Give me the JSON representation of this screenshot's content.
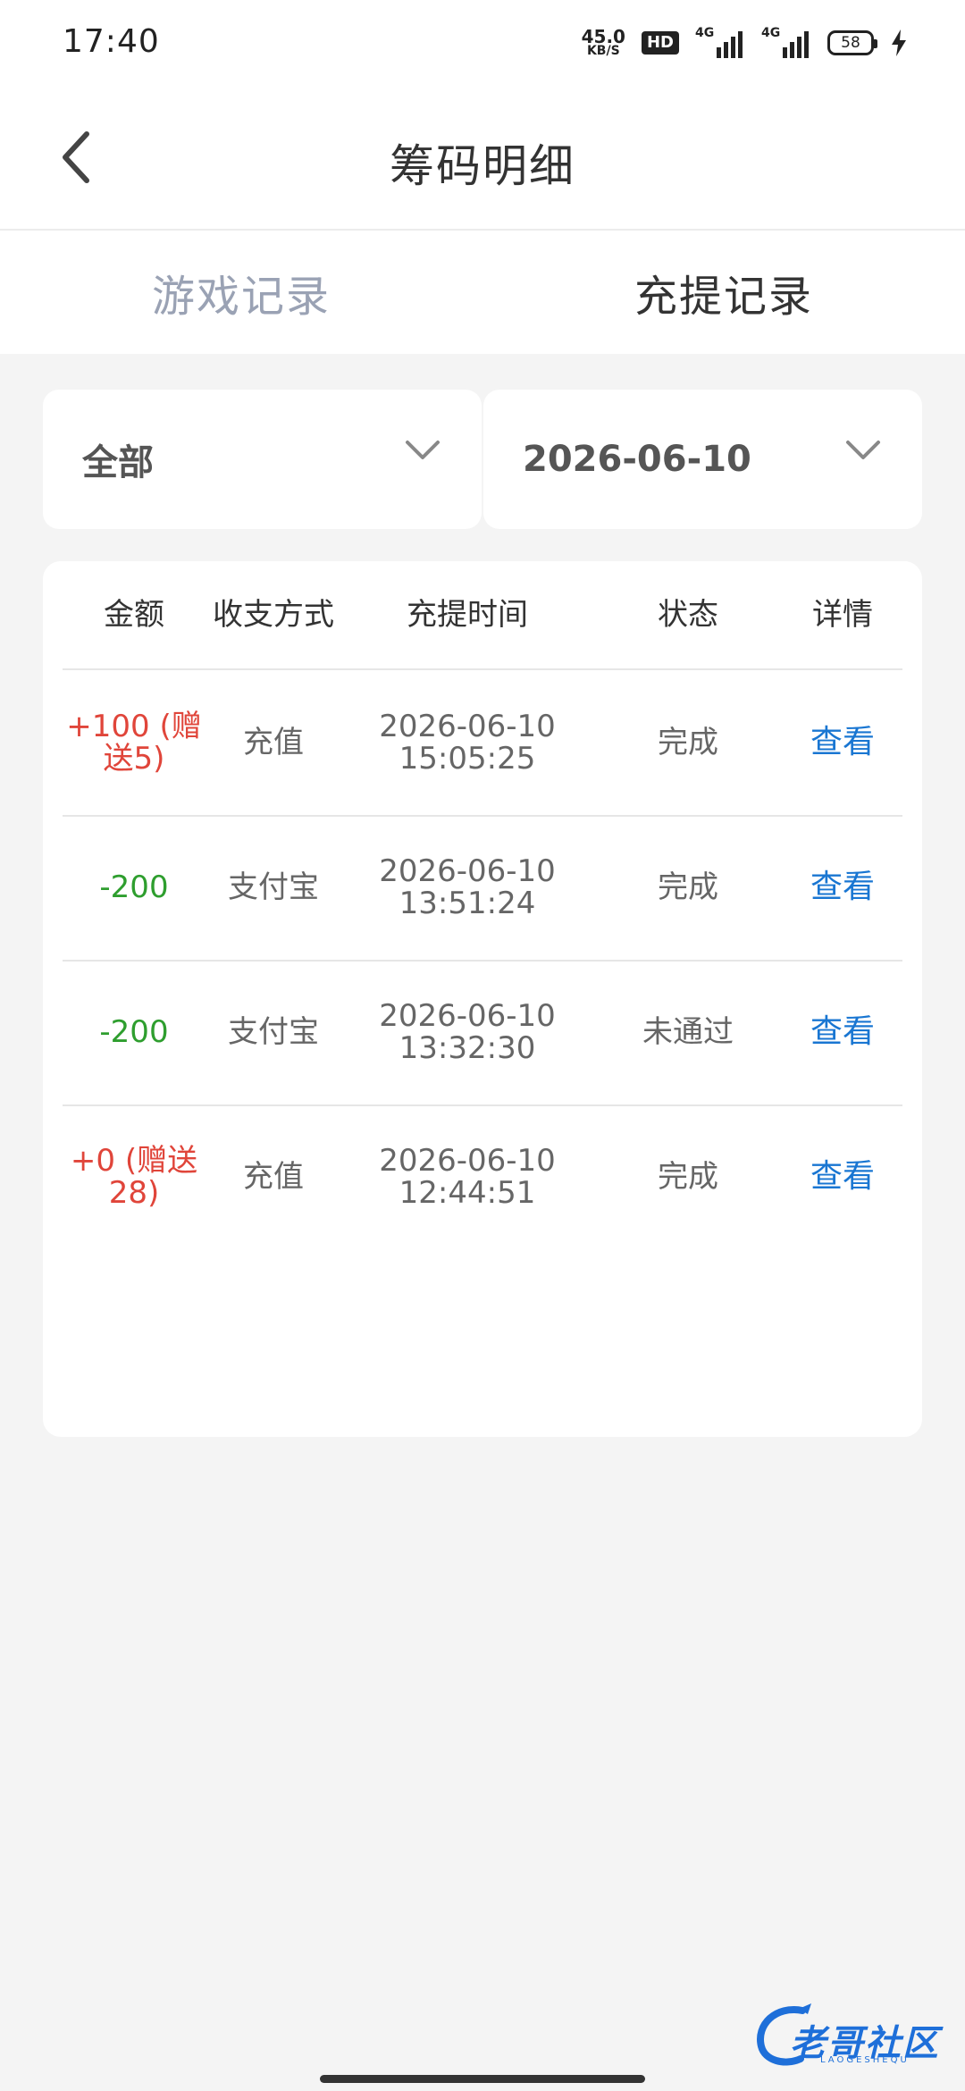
{
  "status_bar": {
    "time": "17:40",
    "net_speed_value": "45.0",
    "net_speed_unit": "KB/S",
    "hd_label": "HD",
    "signal1_label": "4G",
    "signal2_label": "4G",
    "battery_level": "58"
  },
  "header": {
    "title": "筹码明细"
  },
  "tabs": [
    {
      "label": "游戏记录",
      "active": false
    },
    {
      "label": "充提记录",
      "active": true
    }
  ],
  "filters": {
    "type_value": "全部",
    "date_value": "2026-06-10"
  },
  "table": {
    "columns": [
      "金额",
      "收支方式",
      "充提时间",
      "状态",
      "详情"
    ],
    "rows": [
      {
        "amount": "+100 (赠送5)",
        "method": "充值",
        "date": "2026-06-10",
        "time": "15:05:25",
        "status": "完成",
        "action": "查看"
      },
      {
        "amount": "-200",
        "method": "支付宝",
        "date": "2026-06-10",
        "time": "13:51:24",
        "status": "完成",
        "action": "查看"
      },
      {
        "amount": "-200",
        "method": "支付宝",
        "date": "2026-06-10",
        "time": "13:32:30",
        "status": "未通过",
        "action": "查看"
      },
      {
        "amount": "+0 (赠送28)",
        "method": "充值",
        "date": "2026-06-10",
        "time": "12:44:51",
        "status": "完成",
        "action": "查看"
      }
    ]
  },
  "watermark": {
    "text": "老哥社区",
    "sub": "LAOGESHEQU"
  },
  "colors": {
    "positive": "#e0453a",
    "negative": "#2e9e2e",
    "link": "#1976d2",
    "tab_inactive": "#9aa2b4"
  }
}
